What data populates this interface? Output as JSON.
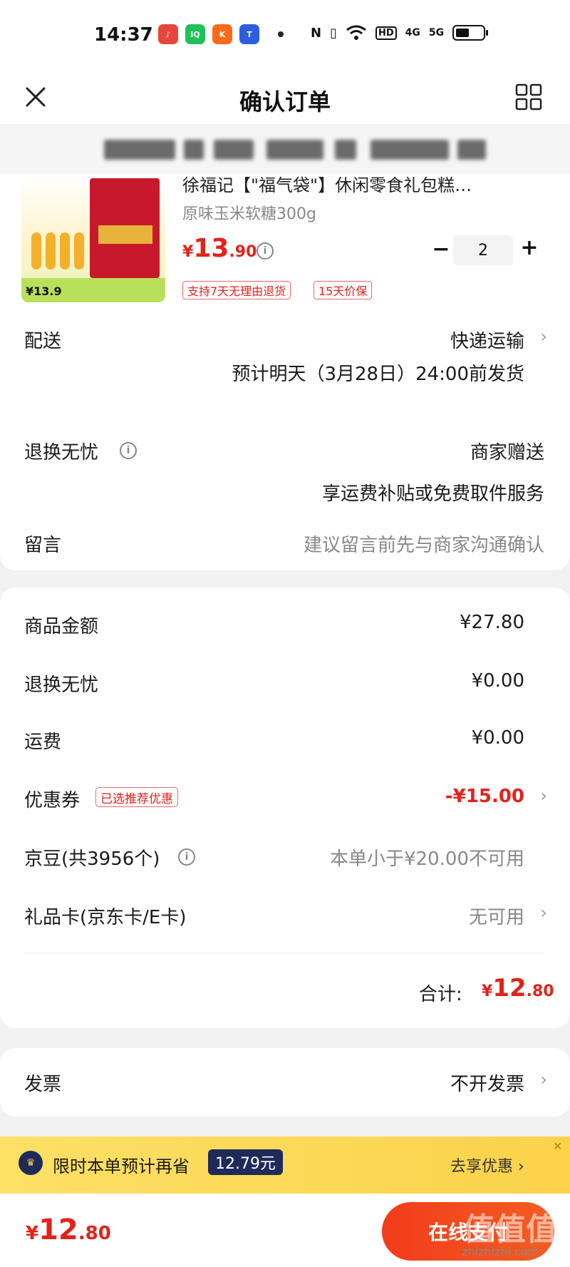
{
  "status_bar": {
    "time": "14:37",
    "apps": [
      "music-app-icon",
      "iqiyi-app-icon",
      "kuaishou-app-icon",
      "tencent-app-icon"
    ],
    "network": "HD",
    "net1": "4G",
    "net2": "5G"
  },
  "header": {
    "title": "确认订单"
  },
  "product": {
    "name": "徐福记【\"福气袋\"】休闲零食礼包糕…",
    "spec": "原味玉米软糖300g",
    "price_currency": "¥",
    "price_int": "13",
    "price_dec": ".90",
    "quantity": "2",
    "minus": "−",
    "plus": "+",
    "tags": [
      "支持7天无理由退货",
      "15天价保"
    ],
    "image_promo_price": "¥13.9"
  },
  "delivery": {
    "label": "配送",
    "method": "快递运输",
    "estimate": "预计明天（3月28日）24:00前发货"
  },
  "return_service": {
    "label": "退换无忧",
    "value": "商家赠送",
    "desc": "享运费补贴或免费取件服务"
  },
  "message": {
    "label": "留言",
    "placeholder": "建议留言前先与商家沟通确认"
  },
  "summary": {
    "goods_label": "商品金额",
    "goods_value": "¥27.80",
    "return_label": "退换无忧",
    "return_value": "¥0.00",
    "shipping_label": "运费",
    "shipping_value": "¥0.00",
    "coupon_label": "优惠券",
    "coupon_tag": "已选推荐优惠",
    "coupon_value": "-¥15.00",
    "jd_beans_label": "京豆(共3956个)",
    "jd_beans_value": "本单小于¥20.00不可用",
    "gift_card_label": "礼品卡(京东卡/E卡)",
    "gift_card_value": "无可用",
    "total_label": "合计:",
    "total_currency": "¥",
    "total_int": "12",
    "total_dec": ".80"
  },
  "invoice": {
    "label": "发票",
    "value": "不开发票"
  },
  "promo_banner": {
    "text": "限时本单预计再省",
    "amount": "12.79元",
    "action": "去享优惠 ›",
    "close": "✕"
  },
  "bottom_bar": {
    "currency": "¥",
    "int": "12",
    "dec": ".80",
    "pay_label": "在线支付",
    "watermark": "值值值",
    "watermark_site": "zhizhizhi.com"
  },
  "colors": {
    "accent_red": "#e2231a",
    "promo_yellow": "#fde066",
    "promo_navy": "#1f2a5a"
  }
}
